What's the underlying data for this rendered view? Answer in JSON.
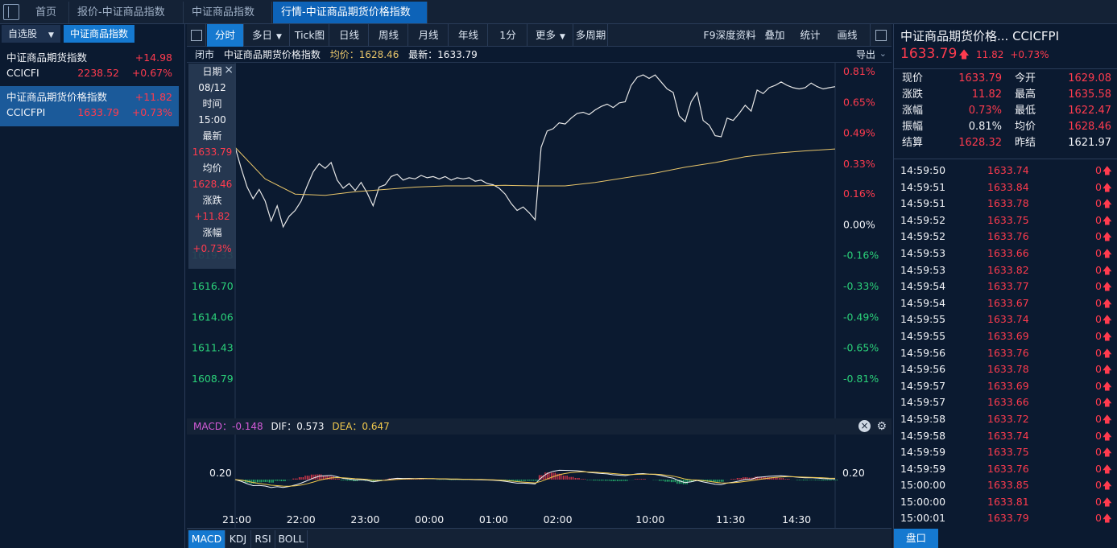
{
  "tabs": [
    {
      "label": "首页"
    },
    {
      "label": "报价-中证商品指数"
    },
    {
      "label": "中证商品指数"
    },
    {
      "label": "行情-中证商品期货价格指数",
      "close": "×"
    }
  ],
  "left": {
    "subtabs": [
      "自选股",
      "中证商品指数"
    ],
    "dropdown_arrow": "▼",
    "items": [
      {
        "name": "中证商品期货指数",
        "code": "CCICFI",
        "price": "2238.52",
        "chg": "+14.98",
        "pct": "+0.67%"
      },
      {
        "name": "中证商品期货价格指数",
        "code": "CCICFPI",
        "price": "1633.79",
        "chg": "+11.82",
        "pct": "+0.73%"
      }
    ]
  },
  "toolbar": {
    "items": [
      "分时",
      "多日",
      "Tick图",
      "日线",
      "周线",
      "月线",
      "年线",
      "1分",
      "更多",
      "多周期"
    ],
    "right_items": [
      "F9深度资料",
      "叠加",
      "统计",
      "画线"
    ],
    "dropdown_arrow": "▼"
  },
  "infobar": {
    "status": "闭市",
    "name": "中证商品期货价格指数",
    "avg_label": "均价：",
    "avg_value": "1628.46",
    "last_label": "最新：",
    "last_value": "1633.79",
    "export": "导出"
  },
  "tooltip": {
    "close": "×",
    "rows": [
      {
        "text": "日期",
        "cls": "white"
      },
      {
        "text": "08/12",
        "cls": "white"
      },
      {
        "text": "时间",
        "cls": "white"
      },
      {
        "text": "15:00",
        "cls": "white"
      },
      {
        "text": "最新",
        "cls": "white"
      },
      {
        "text": "1633.79",
        "cls": "up"
      },
      {
        "text": "均价",
        "cls": "white"
      },
      {
        "text": "1628.46",
        "cls": "up"
      },
      {
        "text": "涨跌",
        "cls": "white"
      },
      {
        "text": "+11.82",
        "cls": "up"
      },
      {
        "text": "涨幅",
        "cls": "white"
      },
      {
        "text": "+0.73%",
        "cls": "up"
      }
    ]
  },
  "chart_data": {
    "type": "line",
    "title": "中证商品期货价格指数",
    "prev_close": 1621.97,
    "ylim": [
      1606.16,
      1635.08
    ],
    "y_ticks_left_visible": [
      "1619.33",
      "1616.70",
      "1614.06",
      "1611.43",
      "1608.79"
    ],
    "y_ticks_left_values": [
      1619.33,
      1616.7,
      1614.06,
      1611.43,
      1608.79
    ],
    "y_ticks_right": [
      "0.81%",
      "0.65%",
      "0.49%",
      "0.33%",
      "0.16%",
      "0.00%",
      "-0.16%",
      "-0.33%",
      "-0.49%",
      "-0.65%",
      "-0.81%"
    ],
    "y_ticks_right_values": [
      1635.08,
      1632.44,
      1629.81,
      1627.17,
      1624.6,
      1621.97,
      1619.33,
      1616.7,
      1614.06,
      1611.43,
      1608.79
    ],
    "x_ticks": [
      "21:00",
      "22:00",
      "23:00",
      "00:00",
      "01:00",
      "02:00",
      "10:00",
      "11:30",
      "14:30"
    ],
    "x_tick_fracs": [
      0,
      0.107,
      0.214,
      0.321,
      0.428,
      0.535,
      0.689,
      0.823,
      0.933
    ],
    "series": [
      {
        "name": "最新",
        "x": [
          0,
          0.01,
          0.02,
          0.03,
          0.04,
          0.05,
          0.06,
          0.07,
          0.08,
          0.09,
          0.1,
          0.11,
          0.12,
          0.13,
          0.14,
          0.15,
          0.16,
          0.17,
          0.18,
          0.19,
          0.2,
          0.21,
          0.22,
          0.23,
          0.24,
          0.25,
          0.26,
          0.27,
          0.28,
          0.29,
          0.3,
          0.31,
          0.32,
          0.33,
          0.34,
          0.35,
          0.36,
          0.37,
          0.38,
          0.39,
          0.4,
          0.41,
          0.42,
          0.43,
          0.44,
          0.45,
          0.46,
          0.47,
          0.48,
          0.49,
          0.5,
          0.51,
          0.52,
          0.53,
          0.54,
          0.55,
          0.56,
          0.57,
          0.58,
          0.59,
          0.6,
          0.61,
          0.62,
          0.63,
          0.64,
          0.65,
          0.66,
          0.67,
          0.68,
          0.69,
          0.7,
          0.71,
          0.72,
          0.73,
          0.74,
          0.75,
          0.76,
          0.77,
          0.78,
          0.79,
          0.8,
          0.81,
          0.82,
          0.83,
          0.84,
          0.85,
          0.86,
          0.87,
          0.88,
          0.89,
          0.9,
          0.91,
          0.92,
          0.93,
          0.94,
          0.95,
          0.96,
          0.97,
          0.98,
          0.99,
          1.0
        ],
        "values": [
          1628.6,
          1626.8,
          1625.2,
          1624.2,
          1625.0,
          1624.0,
          1622.3,
          1623.6,
          1621.8,
          1622.7,
          1623.2,
          1624.0,
          1625.3,
          1626.5,
          1627.2,
          1626.8,
          1627.3,
          1625.8,
          1625.1,
          1625.5,
          1624.9,
          1625.6,
          1624.7,
          1623.6,
          1625.2,
          1625.4,
          1626.1,
          1626.3,
          1625.8,
          1626.0,
          1625.9,
          1626.2,
          1626.0,
          1626.1,
          1625.9,
          1626.1,
          1625.8,
          1626.0,
          1625.9,
          1626.0,
          1625.7,
          1625.8,
          1625.5,
          1625.4,
          1625.1,
          1624.6,
          1623.8,
          1623.2,
          1623.5,
          1623.0,
          1622.4,
          1628.6,
          1630.0,
          1630.2,
          1630.7,
          1630.6,
          1631.1,
          1631.5,
          1631.6,
          1631.4,
          1631.8,
          1632.1,
          1632.3,
          1632.0,
          1632.4,
          1632.5,
          1633.9,
          1634.6,
          1634.8,
          1634.5,
          1634.8,
          1634.2,
          1633.6,
          1633.3,
          1631.3,
          1630.8,
          1632.5,
          1633.3,
          1630.9,
          1630.5,
          1629.6,
          1629.5,
          1631.1,
          1630.9,
          1631.5,
          1632.2,
          1631.7,
          1633.5,
          1633.2,
          1633.7,
          1633.9,
          1634.2,
          1633.9,
          1633.7,
          1633.6,
          1633.7,
          1634.1,
          1633.8,
          1633.6,
          1633.7,
          1633.79
        ],
        "color": "#e6e6e6"
      },
      {
        "name": "均价",
        "x": [
          0,
          0.05,
          0.1,
          0.15,
          0.2,
          0.25,
          0.3,
          0.35,
          0.4,
          0.45,
          0.5,
          0.55,
          0.6,
          0.65,
          0.7,
          0.75,
          0.8,
          0.85,
          0.9,
          0.95,
          1.0
        ],
        "values": [
          1628.6,
          1625.9,
          1624.6,
          1624.5,
          1624.8,
          1625.0,
          1625.2,
          1625.3,
          1625.3,
          1625.35,
          1625.3,
          1625.3,
          1625.6,
          1626.0,
          1626.4,
          1626.9,
          1627.3,
          1627.8,
          1628.1,
          1628.3,
          1628.46
        ],
        "color": "#e8c56a"
      }
    ]
  },
  "macd": {
    "label_macd": "MACD：",
    "value_macd": "-0.148",
    "label_dif": "DIF：",
    "value_dif": "0.573",
    "label_dea": "DEA：",
    "value_dea": "0.647",
    "y_tick": "0.20",
    "close": "×",
    "gear": "⚙",
    "colors": {
      "macd": "#d45bd8",
      "dif": "#f2f4f8",
      "dea": "#f2c94c",
      "up": "#ff3b4e",
      "down": "#2bd27a"
    }
  },
  "bottom_tabs": [
    "MACD",
    "KDJ",
    "RSI",
    "BOLL"
  ],
  "right": {
    "title": "中证商品期货价格...  CCICFPI",
    "price": "1633.79",
    "arrow": "🡅",
    "chg": "11.82",
    "pct": "+0.73%",
    "stats": [
      {
        "label": "现价",
        "value": "1633.79",
        "cls": "up"
      },
      {
        "label": "今开",
        "value": "1629.08",
        "cls": "up"
      },
      {
        "label": "涨跌",
        "value": "11.82",
        "cls": "up"
      },
      {
        "label": "最高",
        "value": "1635.58",
        "cls": "up"
      },
      {
        "label": "涨幅",
        "value": "0.73%",
        "cls": "up"
      },
      {
        "label": "最低",
        "value": "1622.47",
        "cls": "up"
      },
      {
        "label": "振幅",
        "value": "0.81%",
        "cls": "white"
      },
      {
        "label": "均价",
        "value": "1628.46",
        "cls": "up"
      },
      {
        "label": "结算",
        "value": "1628.32",
        "cls": "up"
      },
      {
        "label": "昨结",
        "value": "1621.97",
        "cls": "white"
      }
    ],
    "ticks": [
      {
        "time": "14:59:50",
        "price": "1633.74",
        "qty": "0"
      },
      {
        "time": "14:59:51",
        "price": "1633.84",
        "qty": "0"
      },
      {
        "time": "14:59:51",
        "price": "1633.78",
        "qty": "0"
      },
      {
        "time": "14:59:52",
        "price": "1633.75",
        "qty": "0"
      },
      {
        "time": "14:59:52",
        "price": "1633.76",
        "qty": "0"
      },
      {
        "time": "14:59:53",
        "price": "1633.66",
        "qty": "0"
      },
      {
        "time": "14:59:53",
        "price": "1633.82",
        "qty": "0"
      },
      {
        "time": "14:59:54",
        "price": "1633.77",
        "qty": "0"
      },
      {
        "time": "14:59:54",
        "price": "1633.67",
        "qty": "0"
      },
      {
        "time": "14:59:55",
        "price": "1633.74",
        "qty": "0"
      },
      {
        "time": "14:59:55",
        "price": "1633.69",
        "qty": "0"
      },
      {
        "time": "14:59:56",
        "price": "1633.76",
        "qty": "0"
      },
      {
        "time": "14:59:56",
        "price": "1633.78",
        "qty": "0"
      },
      {
        "time": "14:59:57",
        "price": "1633.69",
        "qty": "0"
      },
      {
        "time": "14:59:57",
        "price": "1633.66",
        "qty": "0"
      },
      {
        "time": "14:59:58",
        "price": "1633.72",
        "qty": "0"
      },
      {
        "time": "14:59:58",
        "price": "1633.74",
        "qty": "0"
      },
      {
        "time": "14:59:59",
        "price": "1633.75",
        "qty": "0"
      },
      {
        "time": "14:59:59",
        "price": "1633.76",
        "qty": "0"
      },
      {
        "time": "15:00:00",
        "price": "1633.85",
        "qty": "0"
      },
      {
        "time": "15:00:00",
        "price": "1633.81",
        "qty": "0"
      },
      {
        "time": "15:00:01",
        "price": "1633.79",
        "qty": "0"
      }
    ],
    "tick_arrow": "🡅",
    "pankou": "盘口"
  }
}
